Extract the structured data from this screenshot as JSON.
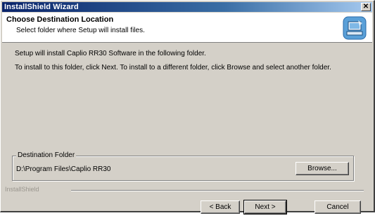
{
  "window": {
    "title": "InstallShield Wizard",
    "close_glyph": "✕"
  },
  "header": {
    "title": "Choose Destination Location",
    "subtitle": "Select folder where Setup will install files.",
    "icon": "installer-computer-icon"
  },
  "body": {
    "line1": "Setup will install Caplio RR30 Software in the following folder.",
    "line2": "To install to this folder, click Next. To install to a different folder, click Browse and select another folder."
  },
  "destination": {
    "legend": "Destination Folder",
    "path": "D:\\Program Files\\Caplio RR30",
    "browse_label": "Browse...",
    "browse_mnemonic": "r"
  },
  "footer": {
    "brand": "InstallShield",
    "back_label": "< Back",
    "next_label": "Next >",
    "cancel_label": "Cancel"
  },
  "colors": {
    "titlebar_start": "#0a246a",
    "titlebar_end": "#a6caf0",
    "face": "#d4d0c8"
  }
}
